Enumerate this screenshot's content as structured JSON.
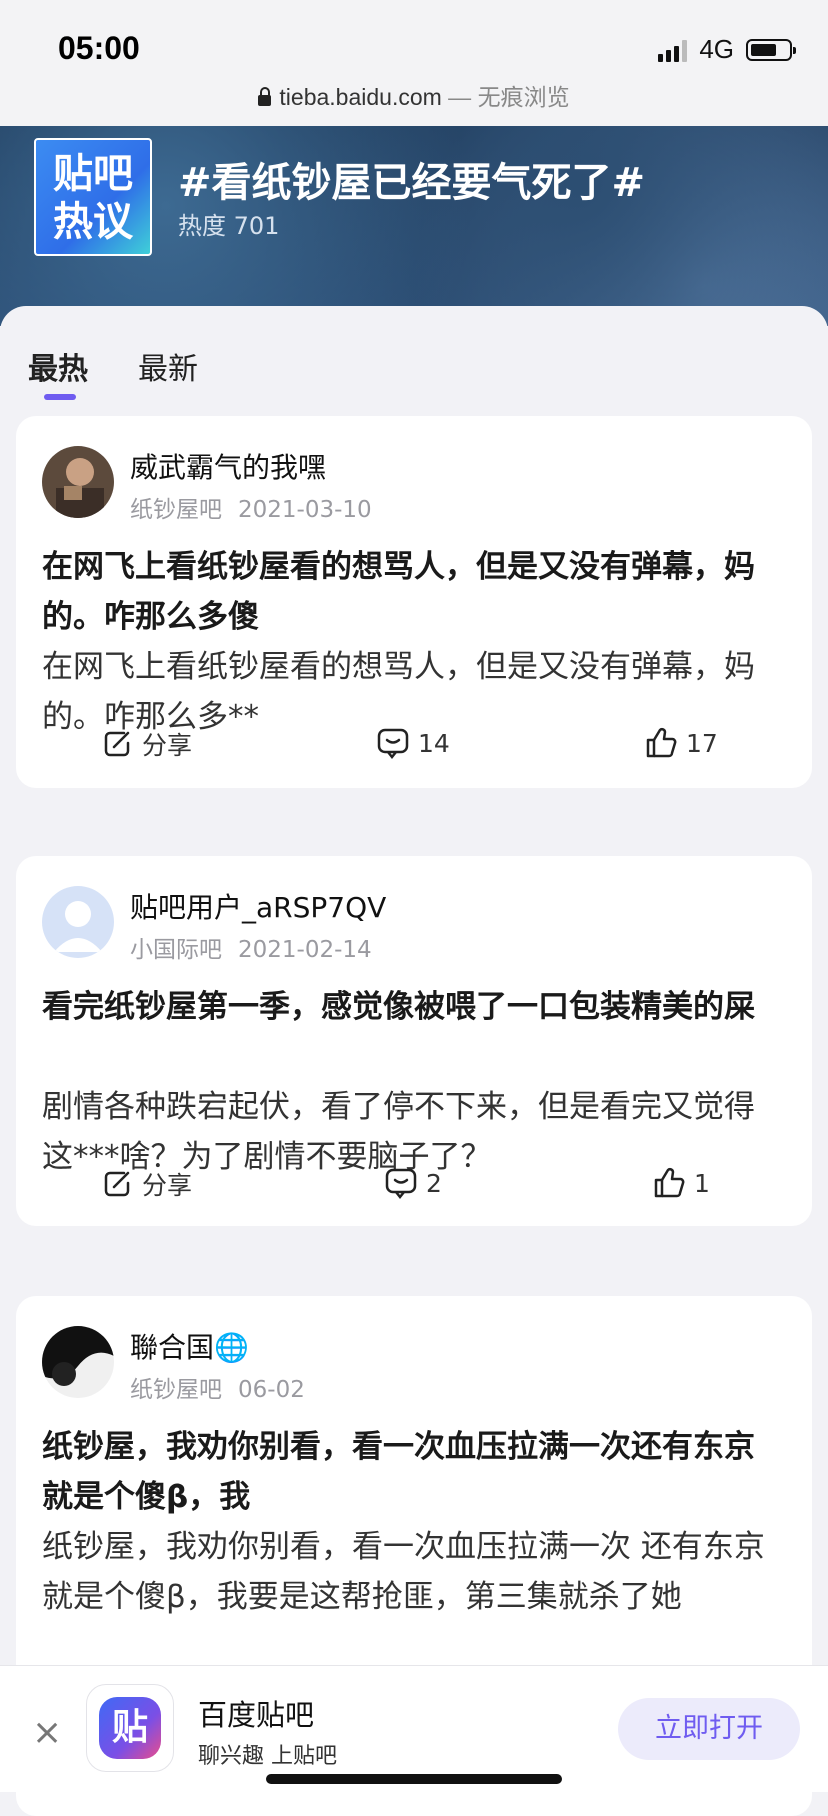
{
  "status_bar": {
    "time": "05:00",
    "network": "4G"
  },
  "url_bar": {
    "domain": "tieba.baidu.com",
    "suffix": " — 无痕浏览"
  },
  "topic": {
    "badge_line1": "贴吧",
    "badge_line2": "热议",
    "title": "#看纸钞屋已经要气死了#",
    "heat": "热度 701"
  },
  "tabs": [
    {
      "label": "最热",
      "active": true
    },
    {
      "label": "最新",
      "active": false
    }
  ],
  "posts": [
    {
      "username": "威武霸气的我嘿",
      "forum": "纸钞屋吧",
      "date": "2021-03-10",
      "title": "在网飞上看纸钞屋看的想骂人，但是又没有弹幕，妈的。咋那么多傻",
      "body": "在网飞上看纸钞屋看的想骂人，但是又没有弹幕，妈的。咋那么多**",
      "share": "分享",
      "comments": "14",
      "likes": "17"
    },
    {
      "username": "贴吧用户_aRSP7QV",
      "forum": "小国际吧",
      "date": "2021-02-14",
      "title": "看完纸钞屋第一季，感觉像被喂了一口包装精美的屎",
      "body": "剧情各种跌宕起伏，看了停不下来，但是看完又觉得这***啥？为了剧情不要脑子了？",
      "share": "分享",
      "comments": "2",
      "likes": "1"
    },
    {
      "username": "聯合国🌐",
      "forum": "纸钞屋吧",
      "date": "06-02",
      "title": "纸钞屋，我劝你别看，看一次血压拉满一次还有东京就是个傻β，我",
      "body": "纸钞屋，我劝你别看，看一次血压拉满一次 还有东京就是个傻β，我要是这帮抢匪，第三集就杀了她"
    }
  ],
  "banner": {
    "close": "×",
    "app_icon_char": "贴",
    "app_name": "百度贴吧",
    "slogan": "聊兴趣 上贴吧",
    "open_button": "立即打开"
  },
  "colors": {
    "accent": "#6f5cf0",
    "hero": "#2b4c73"
  },
  "icons": [
    "lock-icon",
    "signal-icon",
    "battery-icon",
    "share-icon",
    "comment-icon",
    "like-icon",
    "close-icon"
  ]
}
